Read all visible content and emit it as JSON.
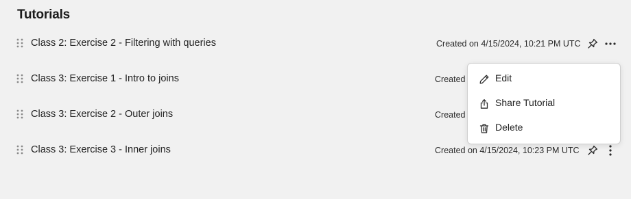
{
  "page": {
    "title": "Tutorials"
  },
  "tutorials": [
    {
      "title": "Class 2: Exercise 2 - Filtering with queries",
      "created": "Created on 4/15/2024, 10:21 PM UTC"
    },
    {
      "title": "Class 3: Exercise 1 - Intro to joins",
      "created": "Created"
    },
    {
      "title": "Class 3: Exercise 2 - Outer joins",
      "created": "Created"
    },
    {
      "title": "Class 3: Exercise 3 - Inner joins",
      "created": "Created on 4/15/2024, 10:23 PM UTC"
    }
  ],
  "menu": {
    "items": [
      {
        "label": "Edit",
        "icon": "pencil-icon"
      },
      {
        "label": "Share Tutorial",
        "icon": "share-icon"
      },
      {
        "label": "Delete",
        "icon": "trash-icon"
      }
    ]
  },
  "colors": {
    "background": "#f1f1f1",
    "menu_background": "#ffffff",
    "menu_border": "#cfcfcf",
    "text": "#222222"
  }
}
